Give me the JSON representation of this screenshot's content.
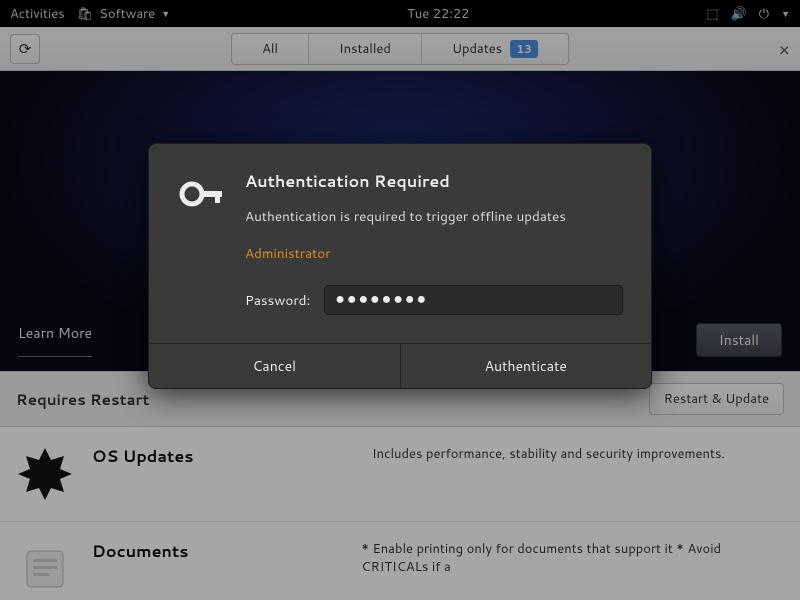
{
  "topbar": {
    "activities": "Activities",
    "app_name": "Software",
    "clock": "Tue 22:22"
  },
  "titlebar": {
    "tabs": {
      "all": "All",
      "installed": "Installed",
      "updates": "Updates",
      "badge": "13"
    }
  },
  "banner": {
    "learn_more": "Learn More",
    "install": "Install"
  },
  "updates": {
    "header": "Requires Restart",
    "restart_btn": "Restart & Update",
    "items": [
      {
        "name": "OS Updates",
        "desc": "Includes performance, stability and security improvements."
      },
      {
        "name": "Documents",
        "desc": "* Enable printing only for documents that support it * Avoid CRITICALs if a"
      }
    ]
  },
  "dialog": {
    "title": "Authentication Required",
    "message": "Authentication is required to trigger offline updates",
    "user": "Administrator",
    "password_label": "Password:",
    "password_value": "●●●●●●●●",
    "cancel": "Cancel",
    "authenticate": "Authenticate"
  }
}
